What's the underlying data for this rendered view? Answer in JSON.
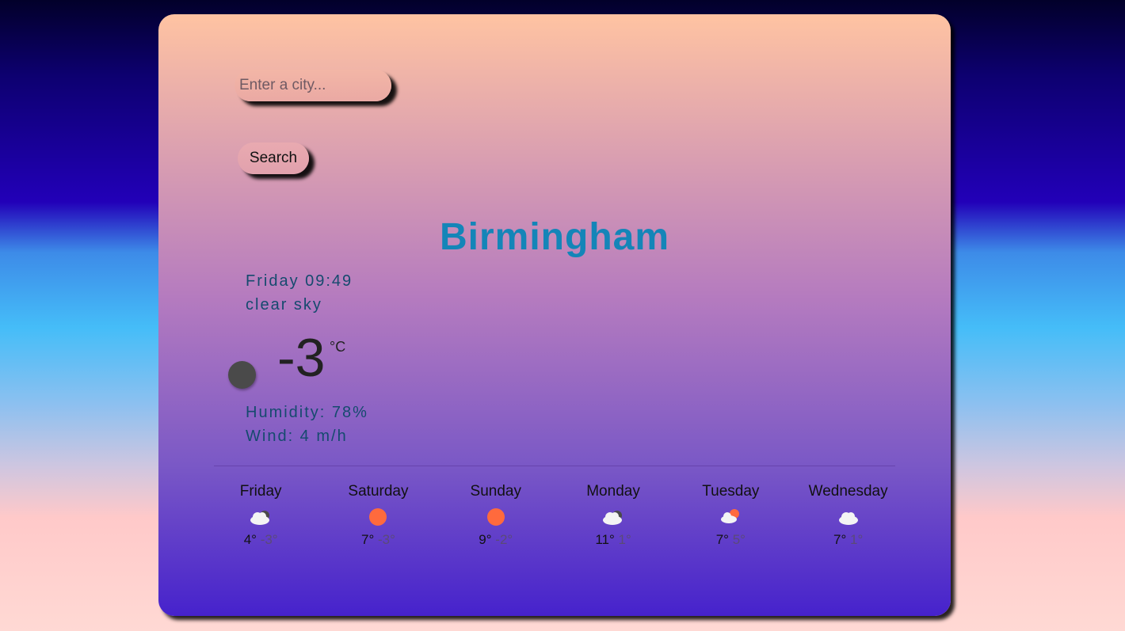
{
  "search": {
    "placeholder": "Enter a city...",
    "button_label": "Search"
  },
  "current": {
    "city": "Birmingham",
    "datetime": "Friday 09:49",
    "description": "clear sky",
    "temperature": "-3",
    "unit": "°C",
    "humidity": "Humidity: 78%",
    "wind": "Wind: 4 m/h"
  },
  "forecast": [
    {
      "day": "Friday",
      "icon": "cloud-night-icon",
      "max": "4°",
      "min": "-3°"
    },
    {
      "day": "Saturday",
      "icon": "sun-icon",
      "max": "7°",
      "min": "-3°"
    },
    {
      "day": "Sunday",
      "icon": "sun-icon",
      "max": "9°",
      "min": "-2°"
    },
    {
      "day": "Monday",
      "icon": "cloud-night-icon",
      "max": "11°",
      "min": "1°"
    },
    {
      "day": "Tuesday",
      "icon": "sun-cloud-icon",
      "max": "7°",
      "min": "5°"
    },
    {
      "day": "Wednesday",
      "icon": "cloud-icon",
      "max": "7°",
      "min": "1°"
    }
  ],
  "colors": {
    "city_name": "#1485b8",
    "sun": "#ff6a3d",
    "info_text": "#154a6e"
  }
}
